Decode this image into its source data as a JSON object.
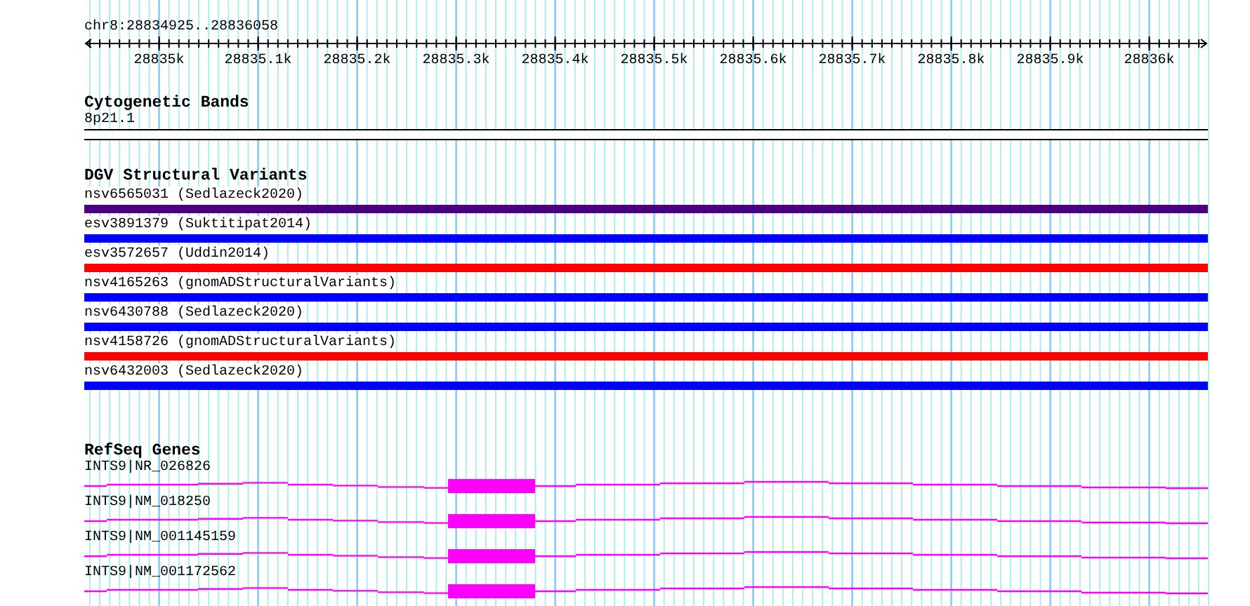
{
  "ruler": {
    "location": "chr8:28834925..28836058",
    "tick_labels": [
      "28835k",
      "28835.1k",
      "28835.2k",
      "28835.3k",
      "28835.4k",
      "28835.5k",
      "28835.6k",
      "28835.7k",
      "28835.8k",
      "28835.9k",
      "28836k"
    ]
  },
  "cytogenetic_bands": {
    "title": "Cytogenetic Bands",
    "features": [
      {
        "name": "8p21.1"
      }
    ]
  },
  "structural_variants": {
    "title": "DGV Structural Variants",
    "features": [
      {
        "name": "nsv6565031 (Sedlazeck2020)",
        "color": "#4b0082"
      },
      {
        "name": "esv3891379 (Suktitipat2014)",
        "color": "#0000ff"
      },
      {
        "name": "esv3572657 (Uddin2014)",
        "color": "#ff0000"
      },
      {
        "name": "nsv4165263 (gnomADStructuralVariants)",
        "color": "#0000ff"
      },
      {
        "name": "nsv6430788 (Sedlazeck2020)",
        "color": "#0000ff"
      },
      {
        "name": "nsv4158726 (gnomADStructuralVariants)",
        "color": "#ff0000"
      },
      {
        "name": "nsv6432003 (Sedlazeck2020)",
        "color": "#0000ff"
      }
    ]
  },
  "refseq_genes": {
    "title": "RefSeq Genes",
    "features": [
      {
        "name": "INTS9|NR_026826"
      },
      {
        "name": "INTS9|NM_018250"
      },
      {
        "name": "INTS9|NM_001145159"
      },
      {
        "name": "INTS9|NM_001172562"
      }
    ]
  }
}
